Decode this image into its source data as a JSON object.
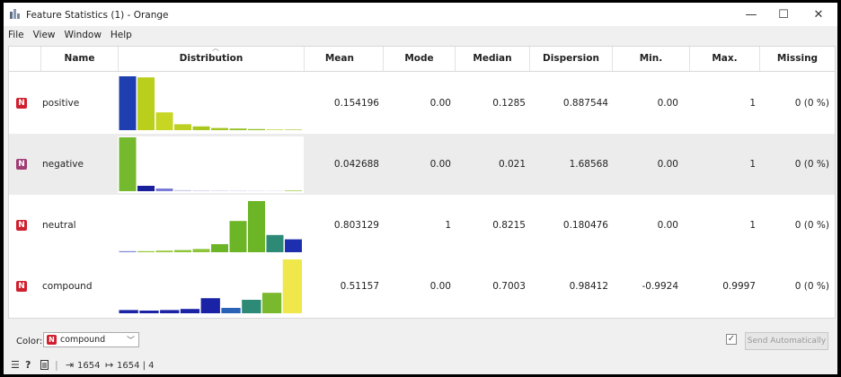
{
  "window": {
    "title": "Feature Statistics (1) - Orange",
    "controls": {
      "minimize": "—",
      "maximize": "☐",
      "close": "✕"
    }
  },
  "menu": [
    "File",
    "View",
    "Window",
    "Help"
  ],
  "columns": [
    "Name",
    "Distribution",
    "Mean",
    "Mode",
    "Median",
    "Dispersion",
    "Min.",
    "Max.",
    "Missing"
  ],
  "rows": [
    {
      "badge": "N",
      "badge_color": "#d01f2e",
      "name": "positive",
      "mean": "0.154196",
      "mode": "0.00",
      "median": "0.1285",
      "dispersion": "0.887544",
      "min": "0.00",
      "max": "1",
      "missing": "0 (0 %)",
      "distribution": {
        "heights": [
          1.0,
          0.98,
          0.33,
          0.11,
          0.07,
          0.04,
          0.03,
          0.02,
          0.01,
          0.01
        ],
        "colors": [
          "#1f3fb0",
          "#b9cf1c",
          "#c6d623",
          "#bccf22",
          "#a8c81f",
          "#a3c520",
          "#94c024",
          "#8fbd23",
          "#cfe06e",
          "#c8dc78"
        ]
      }
    },
    {
      "badge": "N",
      "badge_color": "#a03b73",
      "name": "negative",
      "mean": "0.042688",
      "mode": "0.00",
      "median": "0.021",
      "dispersion": "1.68568",
      "min": "0.00",
      "max": "1",
      "missing": "0 (0 %)",
      "distribution": {
        "heights": [
          1.0,
          0.1,
          0.05,
          0.02,
          0.01,
          0.01,
          0.005,
          0.005,
          0.005,
          0.005
        ],
        "colors": [
          "#74b92e",
          "#1a1f9c",
          "#7a7ad8",
          "#c8c8ea",
          "#d8d8f0",
          "#e0e0f4",
          "#e6e6f6",
          "#eaeaf8",
          "#eeeefa",
          "#b8d870"
        ]
      }
    },
    {
      "badge": "N",
      "badge_color": "#d01f2e",
      "name": "neutral",
      "mean": "0.803129",
      "mode": "1",
      "median": "0.8215",
      "dispersion": "0.180476",
      "min": "0.00",
      "max": "1",
      "missing": "0 (0 %)",
      "distribution": {
        "heights": [
          0.02,
          0.02,
          0.03,
          0.04,
          0.06,
          0.15,
          0.58,
          0.95,
          0.32,
          0.24
        ],
        "colors": [
          "#7d88d6",
          "#9ac83c",
          "#9ac83c",
          "#8cc43a",
          "#8cc43a",
          "#6cb526",
          "#6cb526",
          "#6cb526",
          "#2d8a76",
          "#1d2faf"
        ]
      }
    },
    {
      "badge": "N",
      "badge_color": "#d01f2e",
      "name": "compound",
      "mean": "0.51157",
      "mode": "0.00",
      "median": "0.7003",
      "dispersion": "0.98412",
      "min": "-0.9924",
      "max": "0.9997",
      "missing": "0 (0 %)",
      "distribution": {
        "heights": [
          0.06,
          0.05,
          0.06,
          0.08,
          0.28,
          0.1,
          0.25,
          0.38,
          1.0
        ],
        "colors": [
          "#1a22a6",
          "#1a22a6",
          "#1a22a6",
          "#1a22a6",
          "#1a22a6",
          "#2a62b8",
          "#2d8a76",
          "#7ab82e",
          "#f0e84a"
        ]
      }
    }
  ],
  "controls": {
    "color_label": "Color:",
    "color_badge": "N",
    "color_value": "compound",
    "send_automatically": "Send Automatically",
    "send_checked": true
  },
  "status": {
    "input_count": "1654",
    "output_count": "1654 | 4"
  }
}
